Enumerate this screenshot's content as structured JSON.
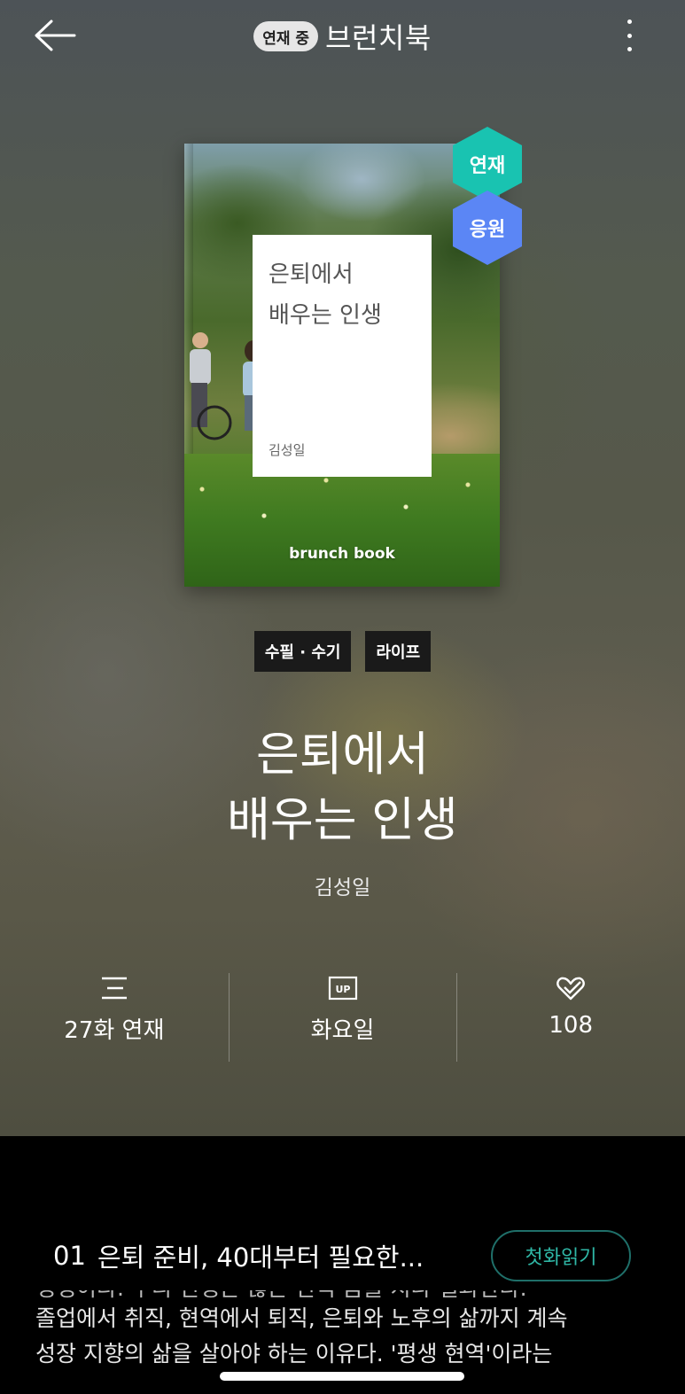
{
  "header": {
    "status_badge": "연재 중",
    "title": "브런치북"
  },
  "cover": {
    "title": "은퇴에서\n배우는 인생",
    "author": "김성일",
    "brand": "brunch book",
    "badges": {
      "serial": "연재",
      "support": "응원"
    }
  },
  "tags": [
    "수필 · 수기",
    "라이프"
  ],
  "book": {
    "title": "은퇴에서\n배우는 인생",
    "author": "김성일"
  },
  "stats": [
    {
      "icon": "list-icon",
      "label": "27화 연재"
    },
    {
      "icon": "up-icon",
      "label": "화요일"
    },
    {
      "icon": "like-icon",
      "label": "108"
    }
  ],
  "episode": {
    "number": "01",
    "title": "은퇴 준비, 40대부터 필요한...",
    "button": "첫화읽기"
  },
  "intro": {
    "clipped_line": "생생이다. 우리 인생은 많은 번덕 즘들 지나 결과한다.",
    "lines": [
      "졸업에서 취직, 현역에서 퇴직, 은퇴와 노후의 삶까지 계속",
      "성장 지향의 삶을 살아야 하는 이유다. '평생 현역'이라는"
    ]
  },
  "colors": {
    "serial_badge": "#19c3b1",
    "support_badge": "#5b86f5",
    "accent_button": "#2fb7a6"
  }
}
